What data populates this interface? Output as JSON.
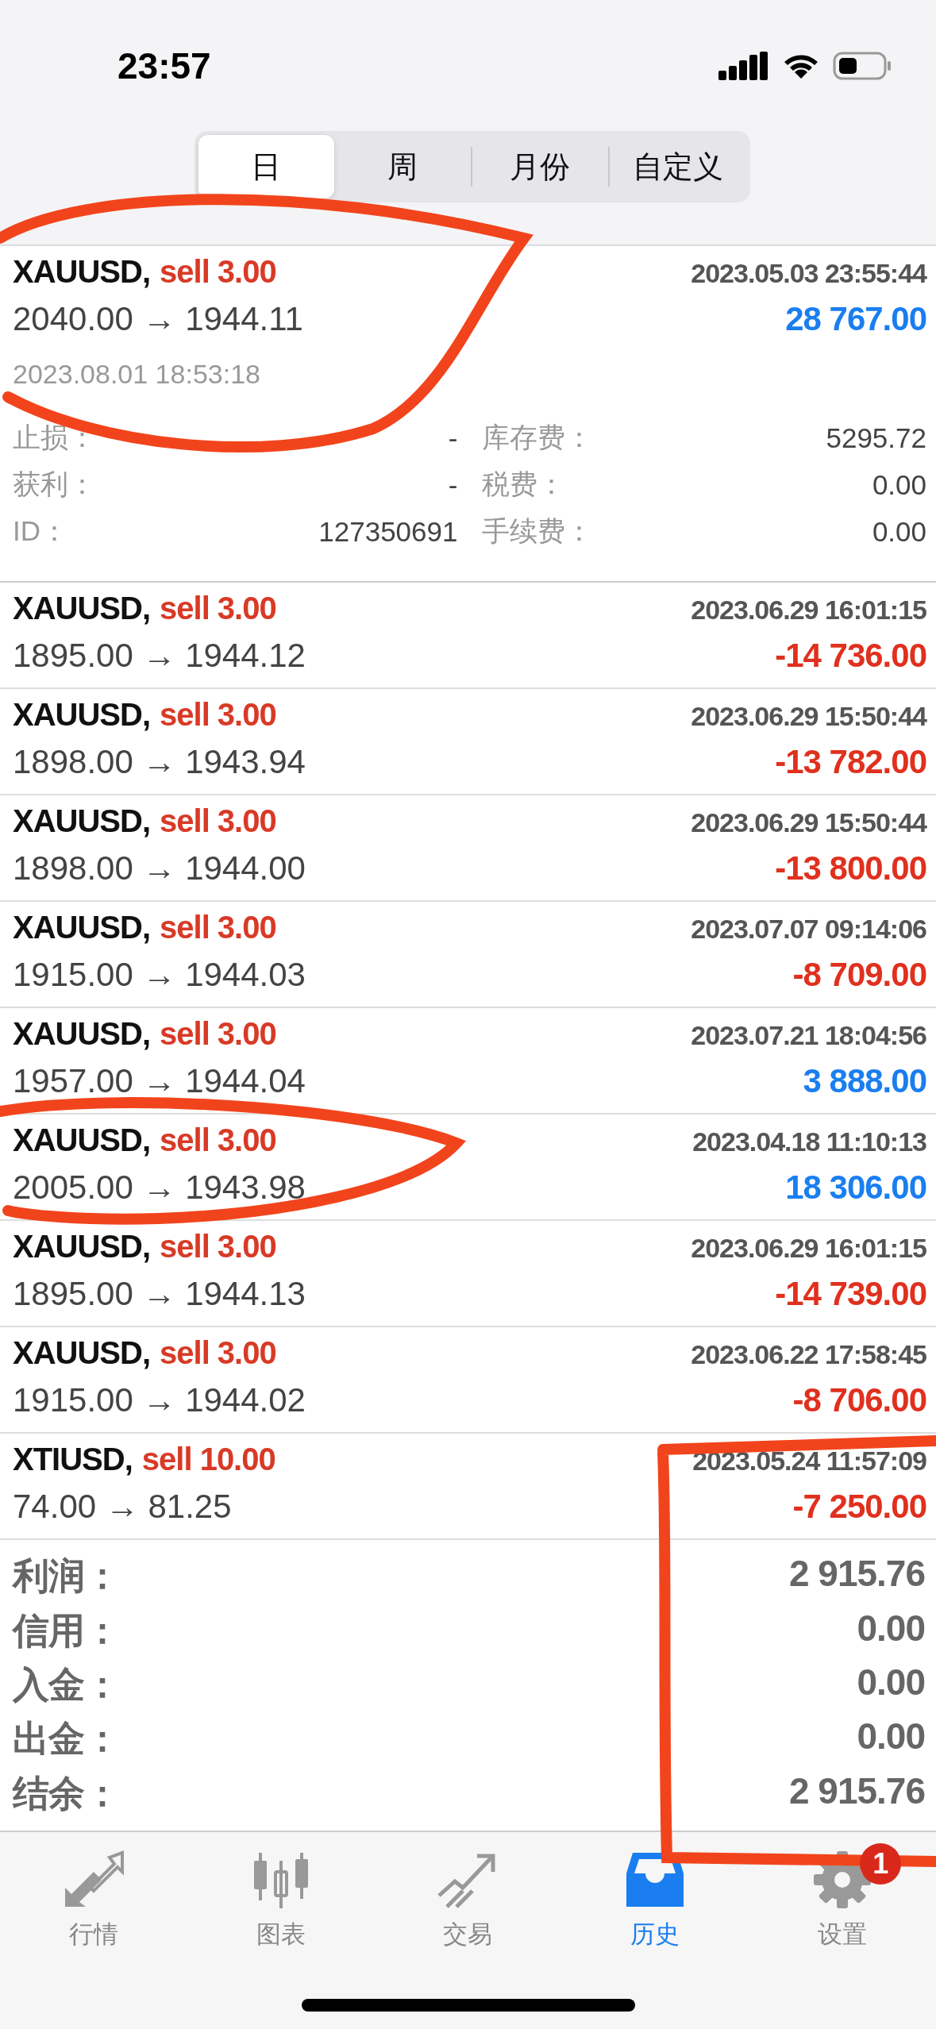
{
  "status_bar": {
    "time": "23:57"
  },
  "period_tabs": [
    {
      "label": "日",
      "selected": true
    },
    {
      "label": "周",
      "selected": false
    },
    {
      "label": "月份",
      "selected": false
    },
    {
      "label": "自定义",
      "selected": false
    }
  ],
  "trades": [
    {
      "symbol": "XAUUSD,",
      "order": "sell 3.00",
      "prices": "2040.00 → 1944.11",
      "time": "2023.05.03 23:55:44",
      "profit": "28 767.00",
      "color": "#1a7ef0",
      "close_time": "2023.08.01 18:53:18",
      "details_left": [
        {
          "label": "止损：",
          "value": "-"
        },
        {
          "label": "获利：",
          "value": "-"
        },
        {
          "label": "ID：",
          "value": "127350691"
        }
      ],
      "details_right": [
        {
          "label": "库存费：",
          "value": "5295.72"
        },
        {
          "label": "税费：",
          "value": "0.00"
        },
        {
          "label": "手续费：",
          "value": "0.00"
        }
      ]
    },
    {
      "symbol": "XAUUSD,",
      "order": "sell 3.00",
      "prices": "1895.00 → 1944.12",
      "time": "2023.06.29 16:01:15",
      "profit": "-14 736.00",
      "color": "#e0301e"
    },
    {
      "symbol": "XAUUSD,",
      "order": "sell 3.00",
      "prices": "1898.00 → 1943.94",
      "time": "2023.06.29 15:50:44",
      "profit": "-13 782.00",
      "color": "#e0301e"
    },
    {
      "symbol": "XAUUSD,",
      "order": "sell 3.00",
      "prices": "1898.00 → 1944.00",
      "time": "2023.06.29 15:50:44",
      "profit": "-13 800.00",
      "color": "#e0301e"
    },
    {
      "symbol": "XAUUSD,",
      "order": "sell 3.00",
      "prices": "1915.00 → 1944.03",
      "time": "2023.07.07 09:14:06",
      "profit": "-8 709.00",
      "color": "#e0301e"
    },
    {
      "symbol": "XAUUSD,",
      "order": "sell 3.00",
      "prices": "1957.00 → 1944.04",
      "time": "2023.07.21 18:04:56",
      "profit": "3 888.00",
      "color": "#1a7ef0"
    },
    {
      "symbol": "XAUUSD,",
      "order": "sell 3.00",
      "prices": "2005.00 → 1943.98",
      "time": "2023.04.18 11:10:13",
      "profit": "18 306.00",
      "color": "#1a7ef0"
    },
    {
      "symbol": "XAUUSD,",
      "order": "sell 3.00",
      "prices": "1895.00 → 1944.13",
      "time": "2023.06.29 16:01:15",
      "profit": "-14 739.00",
      "color": "#e0301e"
    },
    {
      "symbol": "XAUUSD,",
      "order": "sell 3.00",
      "prices": "1915.00 → 1944.02",
      "time": "2023.06.22 17:58:45",
      "profit": "-8 706.00",
      "color": "#e0301e"
    },
    {
      "symbol": "XTIUSD,",
      "order": "sell 10.00",
      "prices": "74.00 → 81.25",
      "time": "2023.05.24 11:57:09",
      "profit": "-7 250.00",
      "color": "#e0301e"
    }
  ],
  "summary": [
    {
      "label": "利润：",
      "value": "2 915.76"
    },
    {
      "label": "信用：",
      "value": "0.00"
    },
    {
      "label": "入金：",
      "value": "0.00"
    },
    {
      "label": "出金：",
      "value": "0.00"
    },
    {
      "label": "结余：",
      "value": "2 915.76"
    }
  ],
  "tab_bar": [
    {
      "label": "行情",
      "selected": false
    },
    {
      "label": "图表",
      "selected": false
    },
    {
      "label": "交易",
      "selected": false
    },
    {
      "label": "历史",
      "selected": true
    },
    {
      "label": "设置",
      "selected": false,
      "badge": "1"
    }
  ]
}
